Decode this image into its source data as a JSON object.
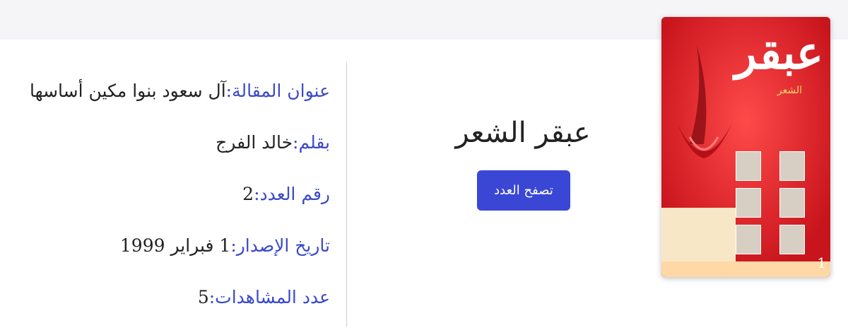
{
  "issue": {
    "cover_number": "1",
    "cover_logo_text": "عبقر",
    "cover_logo_sub": "الشعر",
    "title": "عبقر الشعر",
    "browse_button": "تصفح العدد"
  },
  "details": [
    {
      "label": "عنوان المقالة:",
      "value": " آل سعود بنوا مكين أساسها"
    },
    {
      "label": "بقلم:",
      "value": " خالد الفرج"
    },
    {
      "label": "رقم العدد:",
      "value": " 2"
    },
    {
      "label": "تاريخ الإصدار:",
      "value": "1 فبراير 1999"
    },
    {
      "label": "عدد المشاهدات:",
      "value": " 5"
    }
  ],
  "colors": {
    "label": "#3b49c9",
    "button": "#3a47d5",
    "cover_red": "#e8232b"
  }
}
